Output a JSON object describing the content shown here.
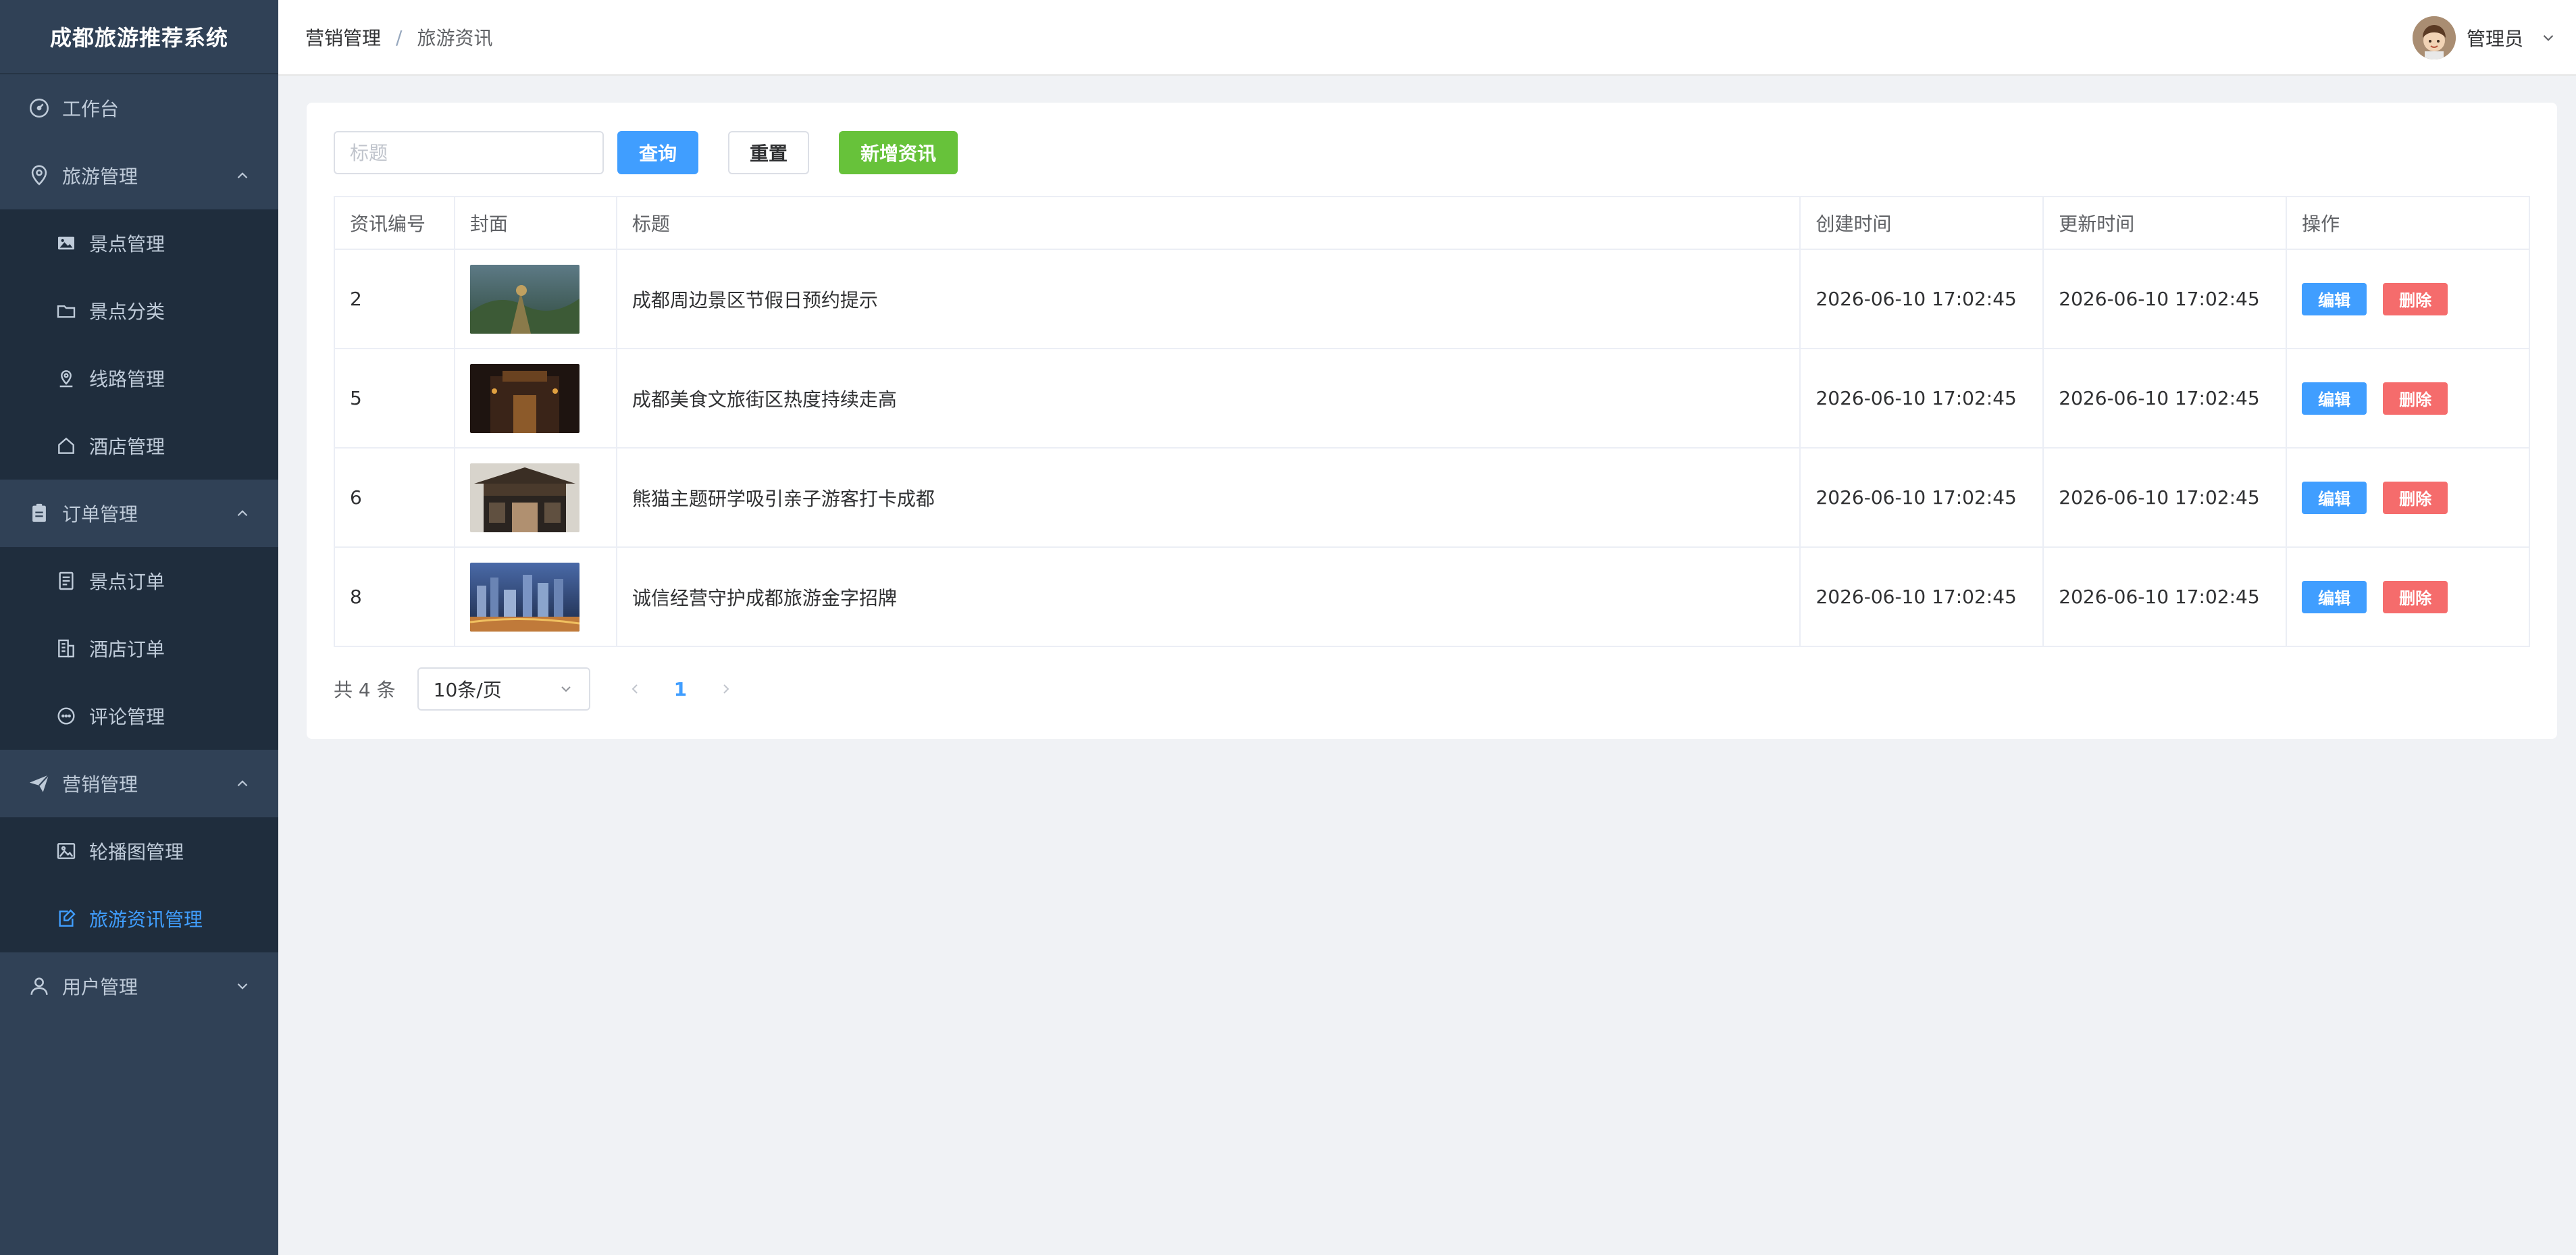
{
  "app": {
    "title": "成都旅游推荐系统"
  },
  "sidebar": {
    "workbench": "工作台",
    "groups": [
      {
        "label": "旅游管理",
        "items": [
          "景点管理",
          "景点分类",
          "线路管理",
          "酒店管理"
        ]
      },
      {
        "label": "订单管理",
        "items": [
          "景点订单",
          "酒店订单",
          "评论管理"
        ]
      },
      {
        "label": "营销管理",
        "items": [
          "轮播图管理",
          "旅游资讯管理"
        ]
      },
      {
        "label": "用户管理"
      }
    ],
    "active_item": "旅游资讯管理"
  },
  "header": {
    "breadcrumb": [
      "营销管理",
      "旅游资讯"
    ],
    "separator": "/",
    "user_name": "管理员"
  },
  "toolbar": {
    "search_placeholder": "标题",
    "search_label": "查询",
    "reset_label": "重置",
    "add_label": "新增资讯"
  },
  "table": {
    "columns": [
      "资讯编号",
      "封面",
      "标题",
      "创建时间",
      "更新时间",
      "操作"
    ],
    "rows": [
      {
        "id": "2",
        "title": "成都周边景区节假日预约提示",
        "created": "2026-06-10 17:02:45",
        "updated": "2026-06-10 17:02:45"
      },
      {
        "id": "5",
        "title": "成都美食文旅街区热度持续走高",
        "created": "2026-06-10 17:02:45",
        "updated": "2026-06-10 17:02:45"
      },
      {
        "id": "6",
        "title": "熊猫主题研学吸引亲子游客打卡成都",
        "created": "2026-06-10 17:02:45",
        "updated": "2026-06-10 17:02:45"
      },
      {
        "id": "8",
        "title": "诚信经营守护成都旅游金字招牌",
        "created": "2026-06-10 17:02:45",
        "updated": "2026-06-10 17:02:45"
      }
    ],
    "edit_label": "编辑",
    "delete_label": "删除"
  },
  "pagination": {
    "total_text": "共 4 条",
    "page_size": "10条/页",
    "current_page": "1"
  },
  "colors": {
    "sidebar_bg": "#304156",
    "accent": "#409eff",
    "success": "#67c23a",
    "danger": "#f56c6c"
  }
}
